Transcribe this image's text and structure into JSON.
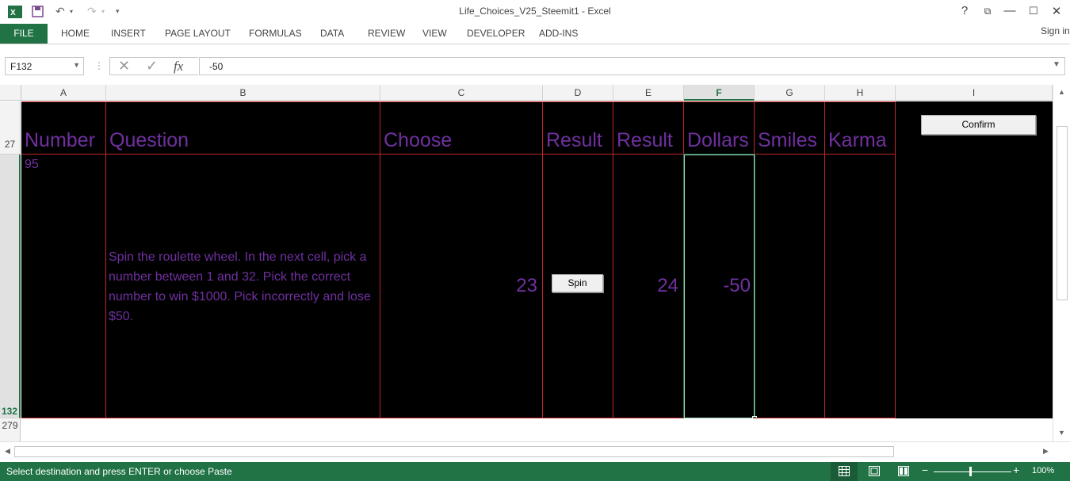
{
  "window": {
    "title": "Life_Choices_V25_Steemit1 - Excel",
    "sign_in": "Sign in"
  },
  "ribbon": {
    "tabs": [
      "FILE",
      "HOME",
      "INSERT",
      "PAGE LAYOUT",
      "FORMULAS",
      "DATA",
      "REVIEW",
      "VIEW",
      "DEVELOPER",
      "ADD-INS"
    ]
  },
  "formula_bar": {
    "name_box": "F132",
    "fx": "fx",
    "value": "-50"
  },
  "columns": [
    "A",
    "B",
    "C",
    "D",
    "E",
    "F",
    "G",
    "H",
    "I"
  ],
  "selected_column": "F",
  "rows": {
    "header_row": "27",
    "content_row": "132",
    "next_row": "279"
  },
  "table": {
    "headers": {
      "number": "Number",
      "question": "Question",
      "choose": "Choose",
      "result1": "Result",
      "result2": "Result",
      "dollars": "Dollars",
      "smiles": "Smiles",
      "karma": "Karma"
    },
    "row": {
      "number": "95",
      "question": "Spin the roulette wheel. In the next cell, pick a number between 1 and 32. Pick the correct number to win $1000. Pick incorrectly and lose $50.",
      "choose": "23",
      "result": "24",
      "dollars": "-50"
    }
  },
  "controls": {
    "confirm": "Confirm",
    "spin": "Spin"
  },
  "status_bar": {
    "message": "Select destination and press ENTER or choose Paste",
    "zoom": "100%"
  },
  "colors": {
    "accent": "#217346",
    "grid_border": "#c0282c",
    "text_purple": "#7030a0",
    "cell_background": "#000000"
  }
}
